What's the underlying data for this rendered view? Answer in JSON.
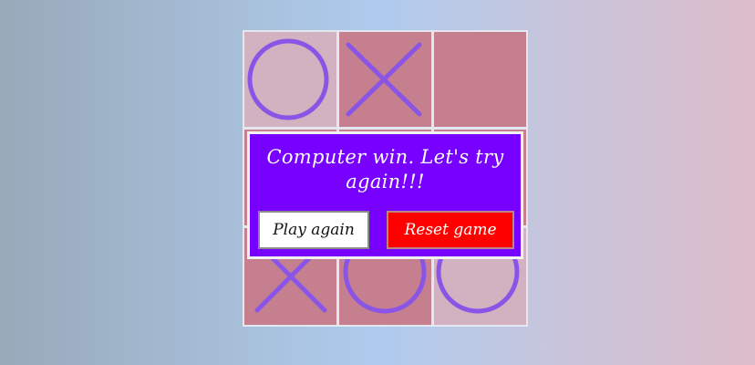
{
  "board": {
    "cells": [
      {
        "mark": "O",
        "shade": "light"
      },
      {
        "mark": "X",
        "shade": "dark"
      },
      {
        "mark": "",
        "shade": "dark"
      },
      {
        "mark": "",
        "shade": "dark"
      },
      {
        "mark": "",
        "shade": "dark"
      },
      {
        "mark": "",
        "shade": "dark"
      },
      {
        "mark": "X",
        "shade": "dark"
      },
      {
        "mark": "O",
        "shade": "dark"
      },
      {
        "mark": "O",
        "shade": "light"
      }
    ],
    "mark_color": "#8a55e6"
  },
  "dialog": {
    "message": "Computer win. Let's try again!!!",
    "play_again_label": "Play again",
    "reset_game_label": "Reset game",
    "background_color": "#7700ff",
    "reset_color": "#ff0000"
  }
}
